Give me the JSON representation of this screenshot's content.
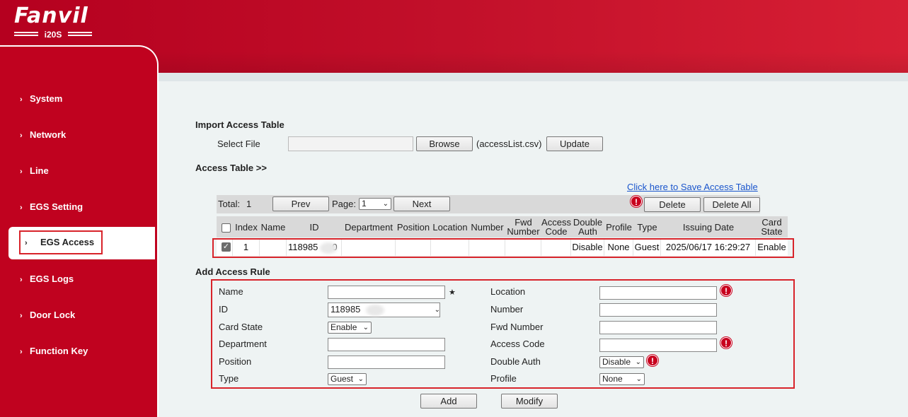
{
  "header": {
    "brand": "Fanvil",
    "model": "i20S"
  },
  "sidebar": {
    "items": [
      {
        "label": "System"
      },
      {
        "label": "Network"
      },
      {
        "label": "Line"
      },
      {
        "label": "EGS Setting"
      },
      {
        "label": "EGS Access"
      },
      {
        "label": "EGS Logs"
      },
      {
        "label": "Door Lock"
      },
      {
        "label": "Function Key"
      }
    ],
    "active": "EGS Access"
  },
  "import": {
    "title": "Import Access Table",
    "select_file_label": "Select File",
    "browse_label": "Browse",
    "file_hint": "(accessList.csv)",
    "update_label": "Update"
  },
  "access_table": {
    "title": "Access Table >>",
    "save_link": "Click here to Save Access Table",
    "total_label": "Total:",
    "total_value": "1",
    "prev_label": "Prev",
    "page_label": "Page:",
    "page_value": "1",
    "next_label": "Next",
    "delete_label": "Delete",
    "delete_all_label": "Delete All",
    "columns": [
      "Index",
      "Name",
      "ID",
      "Department",
      "Position",
      "Location",
      "Number",
      "Fwd Number",
      "Access Code",
      "Double Auth",
      "Profile",
      "Type",
      "Issuing Date",
      "Card State"
    ],
    "rows": [
      {
        "index": "1",
        "name": "",
        "id": "118985",
        "id_tail": "0",
        "department": "",
        "position": "",
        "location": "",
        "number": "",
        "fwd_number": "",
        "access_code": "",
        "double_auth": "Disable",
        "profile": "None",
        "type": "Guest",
        "issuing_date": "2025/06/17 16:29:27",
        "card_state": "Enable"
      }
    ]
  },
  "add_rule": {
    "title": "Add Access Rule",
    "name_label": "Name",
    "id_label": "ID",
    "id_value": "118985",
    "card_state_label": "Card State",
    "card_state_value": "Enable",
    "department_label": "Department",
    "position_label": "Position",
    "type_label": "Type",
    "type_value": "Guest",
    "location_label": "Location",
    "number_label": "Number",
    "fwd_number_label": "Fwd Number",
    "access_code_label": "Access Code",
    "double_auth_label": "Double Auth",
    "double_auth_value": "Disable",
    "profile_label": "Profile",
    "profile_value": "None",
    "required_mark": "★",
    "add_label": "Add",
    "modify_label": "Modify"
  },
  "icons": {
    "warning": "warning-icon",
    "chevron": "chevron-right-icon"
  },
  "colors": {
    "brand_red": "#c0021f",
    "highlight_red": "#d8232a",
    "link_blue": "#1a55cc"
  }
}
